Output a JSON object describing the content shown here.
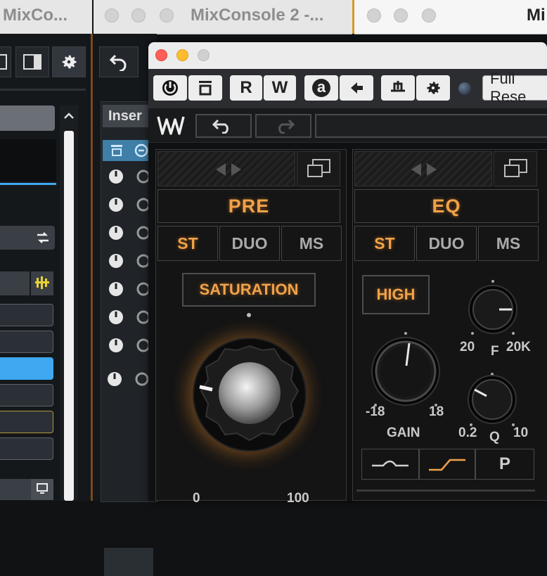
{
  "tabs": [
    {
      "title": "MixCo..."
    },
    {
      "title": "MixConsole 2 -..."
    },
    {
      "title": "Mi"
    }
  ],
  "inserts": {
    "header": "Inser"
  },
  "plugin": {
    "preset": "Full Rese",
    "host": {
      "read_label": "R",
      "write_label": "W",
      "auto_label": "a"
    },
    "pre": {
      "title": "PRE",
      "modes": [
        "ST",
        "DUO",
        "MS"
      ],
      "active_mode": "ST",
      "saturation_label": "SATURATION",
      "saturation": {
        "min": "0",
        "max": "100",
        "value": 8
      }
    },
    "eq": {
      "title": "EQ",
      "modes": [
        "ST",
        "DUO",
        "MS"
      ],
      "active_mode": "ST",
      "band_label": "HIGH",
      "freq": {
        "label": "F",
        "min": "20",
        "max": "20K"
      },
      "gain": {
        "label": "GAIN",
        "min": "-18",
        "max": "18"
      },
      "q": {
        "label": "Q",
        "min": "0.2",
        "max": "10"
      },
      "filter_p_label": "P"
    }
  },
  "colors": {
    "accent": "#f0a24a",
    "cubase_blue": "#3ea8f0",
    "yellow_outline": "#b09a3a"
  }
}
